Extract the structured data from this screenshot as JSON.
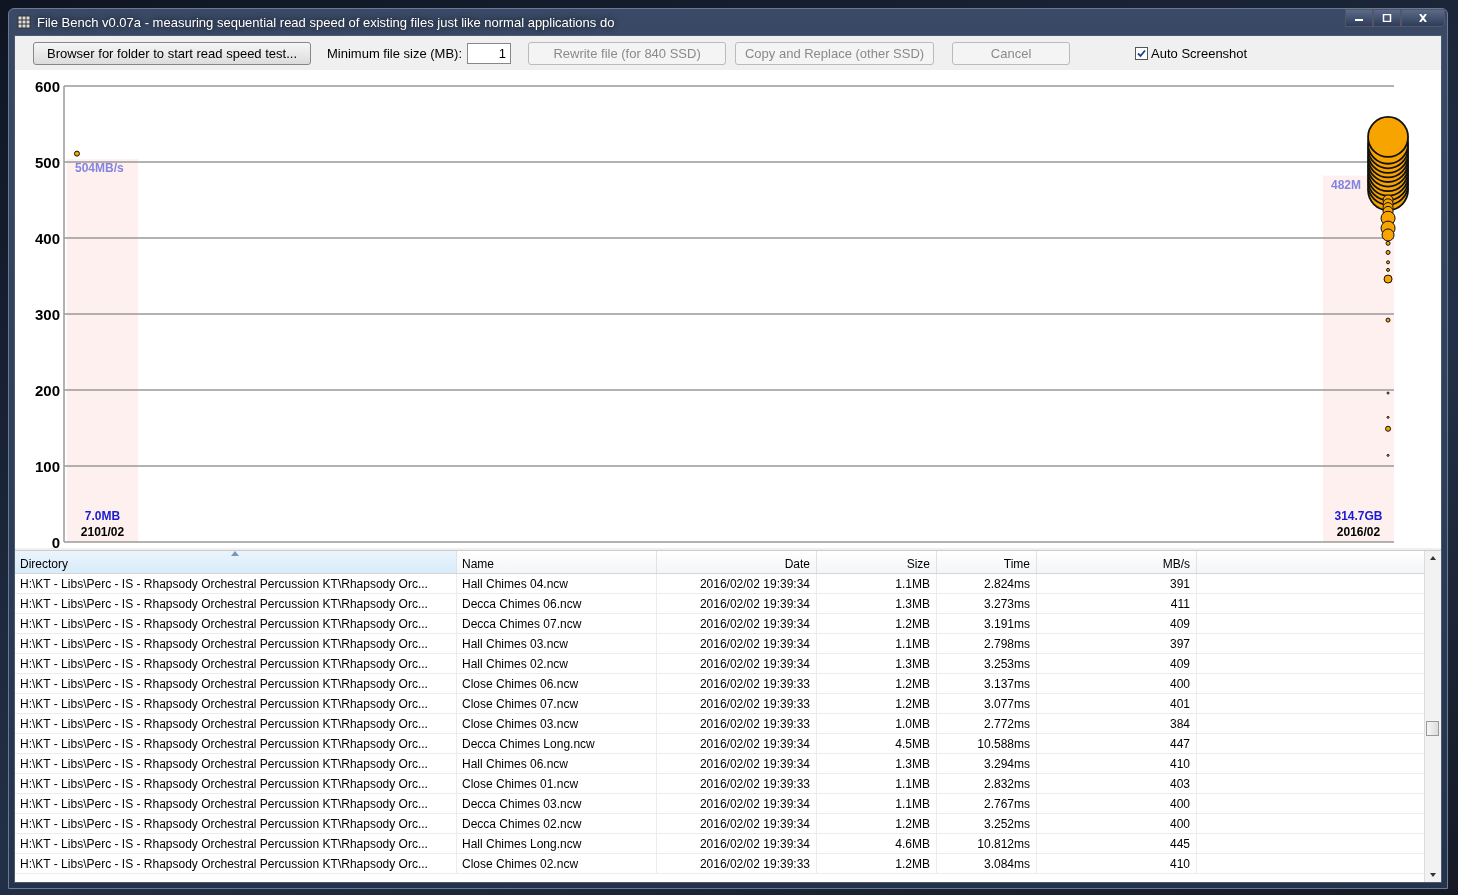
{
  "window": {
    "title": "File Bench v0.07a - measuring sequential read speed of existing files just like normal applications do"
  },
  "toolbar": {
    "browse_button": {
      "label": "Browser for folder to start read speed test...",
      "disabled": false
    },
    "min_size": {
      "label": "Minimum file size (MB):",
      "value": "1"
    },
    "buttons": [
      {
        "label": "Rewrite file (for 840 SSD)",
        "disabled": true
      },
      {
        "label": "Copy and Replace (other SSD)",
        "disabled": true
      },
      {
        "label": "Cancel",
        "disabled": true
      }
    ],
    "auto_screenshot": {
      "label": "Auto Screenshot",
      "checked": true
    }
  },
  "chart": {
    "y_ticks": [
      "600",
      "500",
      "400",
      "300",
      "200",
      "100",
      "0"
    ],
    "groups": [
      {
        "date": "2101/02",
        "total": "7.0MB",
        "speed": "504MB/s"
      },
      {
        "date": "2016/02",
        "total": "314.7GB",
        "speed": "482M"
      }
    ]
  },
  "table": {
    "columns": [
      {
        "label": "Directory",
        "sorted": true
      },
      {
        "label": "Name",
        "sorted": false
      },
      {
        "label": "Date",
        "sorted": false
      },
      {
        "label": "Size",
        "sorted": false
      },
      {
        "label": "Time",
        "sorted": false
      },
      {
        "label": "MB/s",
        "sorted": false
      }
    ],
    "rows": [
      [
        "H:\\KT - Libs\\Perc - IS - Rhapsody Orchestral Percussion KT\\Rhapsody Orc...",
        "Hall Chimes 04.ncw",
        "2016/02/02 19:39:34",
        "1.1MB",
        "2.824ms",
        "391"
      ],
      [
        "H:\\KT - Libs\\Perc - IS - Rhapsody Orchestral Percussion KT\\Rhapsody Orc...",
        "Decca Chimes 06.ncw",
        "2016/02/02 19:39:34",
        "1.3MB",
        "3.273ms",
        "411"
      ],
      [
        "H:\\KT - Libs\\Perc - IS - Rhapsody Orchestral Percussion KT\\Rhapsody Orc...",
        "Decca Chimes 07.ncw",
        "2016/02/02 19:39:34",
        "1.2MB",
        "3.191ms",
        "409"
      ],
      [
        "H:\\KT - Libs\\Perc - IS - Rhapsody Orchestral Percussion KT\\Rhapsody Orc...",
        "Hall Chimes 03.ncw",
        "2016/02/02 19:39:34",
        "1.1MB",
        "2.798ms",
        "397"
      ],
      [
        "H:\\KT - Libs\\Perc - IS - Rhapsody Orchestral Percussion KT\\Rhapsody Orc...",
        "Hall Chimes 02.ncw",
        "2016/02/02 19:39:34",
        "1.3MB",
        "3.253ms",
        "409"
      ],
      [
        "H:\\KT - Libs\\Perc - IS - Rhapsody Orchestral Percussion KT\\Rhapsody Orc...",
        "Close Chimes 06.ncw",
        "2016/02/02 19:39:33",
        "1.2MB",
        "3.137ms",
        "400"
      ],
      [
        "H:\\KT - Libs\\Perc - IS - Rhapsody Orchestral Percussion KT\\Rhapsody Orc...",
        "Close Chimes 07.ncw",
        "2016/02/02 19:39:33",
        "1.2MB",
        "3.077ms",
        "401"
      ],
      [
        "H:\\KT - Libs\\Perc - IS - Rhapsody Orchestral Percussion KT\\Rhapsody Orc...",
        "Close Chimes 03.ncw",
        "2016/02/02 19:39:33",
        "1.0MB",
        "2.772ms",
        "384"
      ],
      [
        "H:\\KT - Libs\\Perc - IS - Rhapsody Orchestral Percussion KT\\Rhapsody Orc...",
        "Decca Chimes Long.ncw",
        "2016/02/02 19:39:34",
        "4.5MB",
        "10.588ms",
        "447"
      ],
      [
        "H:\\KT - Libs\\Perc - IS - Rhapsody Orchestral Percussion KT\\Rhapsody Orc...",
        "Hall Chimes 06.ncw",
        "2016/02/02 19:39:34",
        "1.3MB",
        "3.294ms",
        "410"
      ],
      [
        "H:\\KT - Libs\\Perc - IS - Rhapsody Orchestral Percussion KT\\Rhapsody Orc...",
        "Close Chimes 01.ncw",
        "2016/02/02 19:39:33",
        "1.1MB",
        "2.832ms",
        "403"
      ],
      [
        "H:\\KT - Libs\\Perc - IS - Rhapsody Orchestral Percussion KT\\Rhapsody Orc...",
        "Decca Chimes 03.ncw",
        "2016/02/02 19:39:34",
        "1.1MB",
        "2.767ms",
        "400"
      ],
      [
        "H:\\KT - Libs\\Perc - IS - Rhapsody Orchestral Percussion KT\\Rhapsody Orc...",
        "Decca Chimes 02.ncw",
        "2016/02/02 19:39:34",
        "1.2MB",
        "3.252ms",
        "400"
      ],
      [
        "H:\\KT - Libs\\Perc - IS - Rhapsody Orchestral Percussion KT\\Rhapsody Orc...",
        "Hall Chimes Long.ncw",
        "2016/02/02 19:39:34",
        "4.6MB",
        "10.812ms",
        "445"
      ],
      [
        "H:\\KT - Libs\\Perc - IS - Rhapsody Orchestral Percussion KT\\Rhapsody Orc...",
        "Close Chimes 02.ncw",
        "2016/02/02 19:39:33",
        "1.2MB",
        "3.084ms",
        "410"
      ]
    ]
  }
}
